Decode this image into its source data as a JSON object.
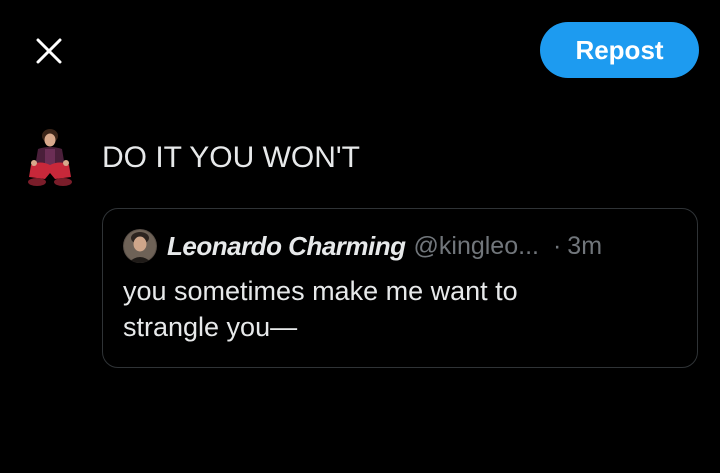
{
  "header": {
    "close_icon": "close-icon",
    "repost_label": "Repost",
    "accent_color": "#1d9bf0"
  },
  "composer": {
    "avatar_icon": "user-avatar",
    "text": "DO IT YOU WON'T"
  },
  "quoted_post": {
    "avatar_icon": "user-avatar",
    "display_name": "Leonardo Charming",
    "handle": "@kingleo...",
    "separator": "·",
    "time": "3m",
    "body": "you sometimes make me want to strangle you—"
  }
}
